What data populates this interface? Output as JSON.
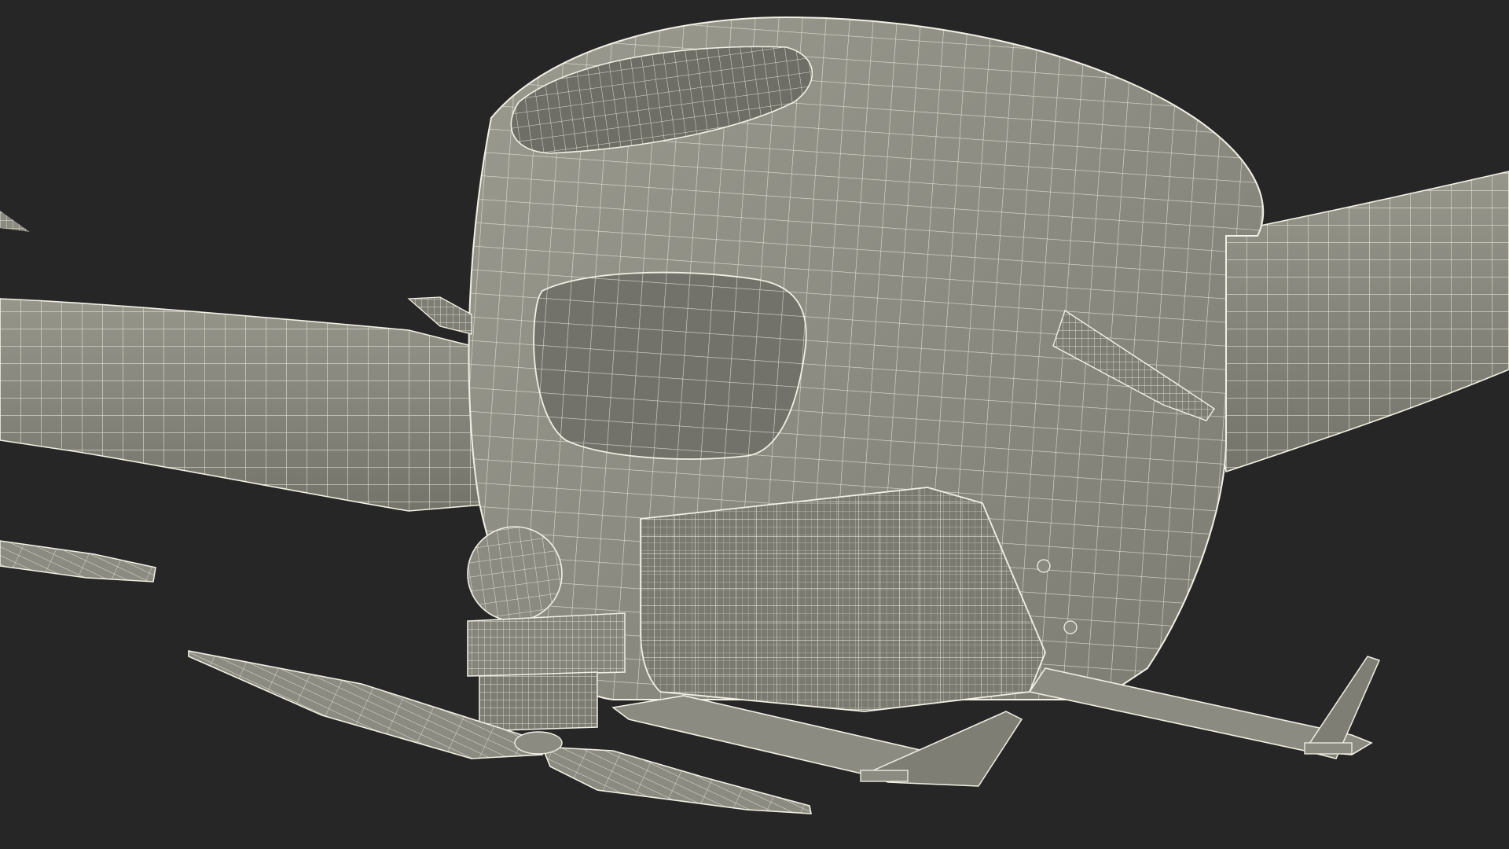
{
  "scene": {
    "background_color": "#262626",
    "surface_color": "#8b8b81",
    "surface_shadow_color": "#6b6b63",
    "surface_light_color": "#a3a398",
    "wire_color": "#f2f0e4",
    "subject": "wireframe-drone-model"
  }
}
